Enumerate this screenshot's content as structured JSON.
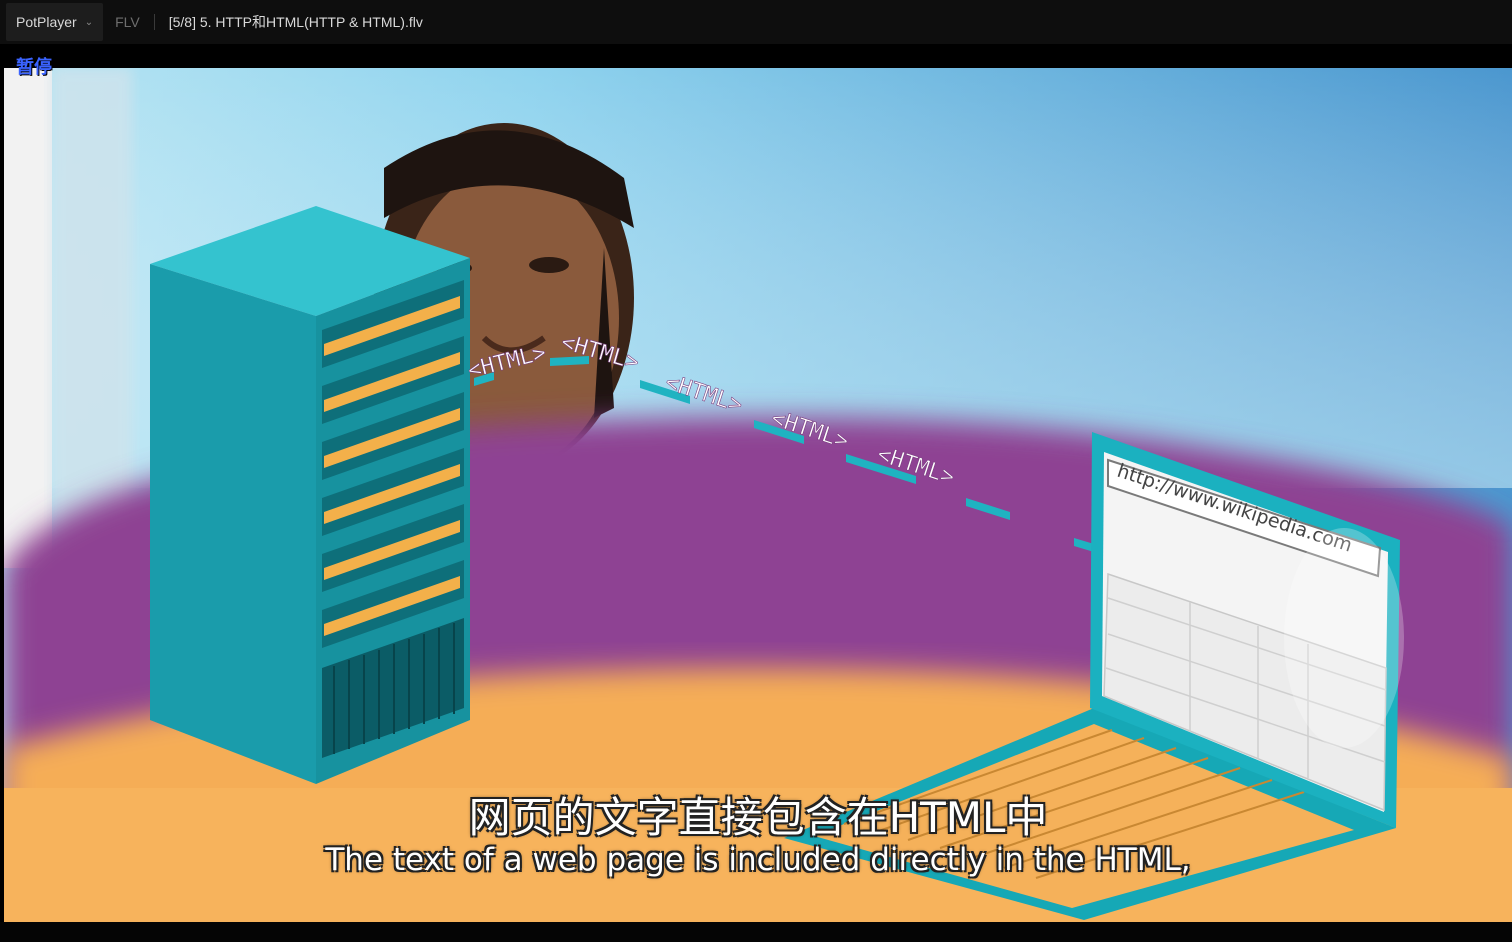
{
  "titlebar": {
    "app_name": "PotPlayer",
    "format": "FLV",
    "file_title": "[5/8] 5. HTTP和HTML(HTTP & HTML).flv"
  },
  "player": {
    "status": "暂停"
  },
  "video": {
    "url_text": "http://www.wikipedia.com",
    "html_tags": [
      "<HTML>",
      "<HTML>",
      "<HTML>",
      "<HTML>",
      "<HTML>"
    ]
  },
  "subtitles": {
    "chinese": "网页的文字直接包含在HTML中",
    "english": "The text of a web page is included directly in the HTML,"
  },
  "colors": {
    "server": "#1aa7b6",
    "purple": "#8e4393",
    "orange": "#f5ad56",
    "sky": "#7cc7ea"
  }
}
